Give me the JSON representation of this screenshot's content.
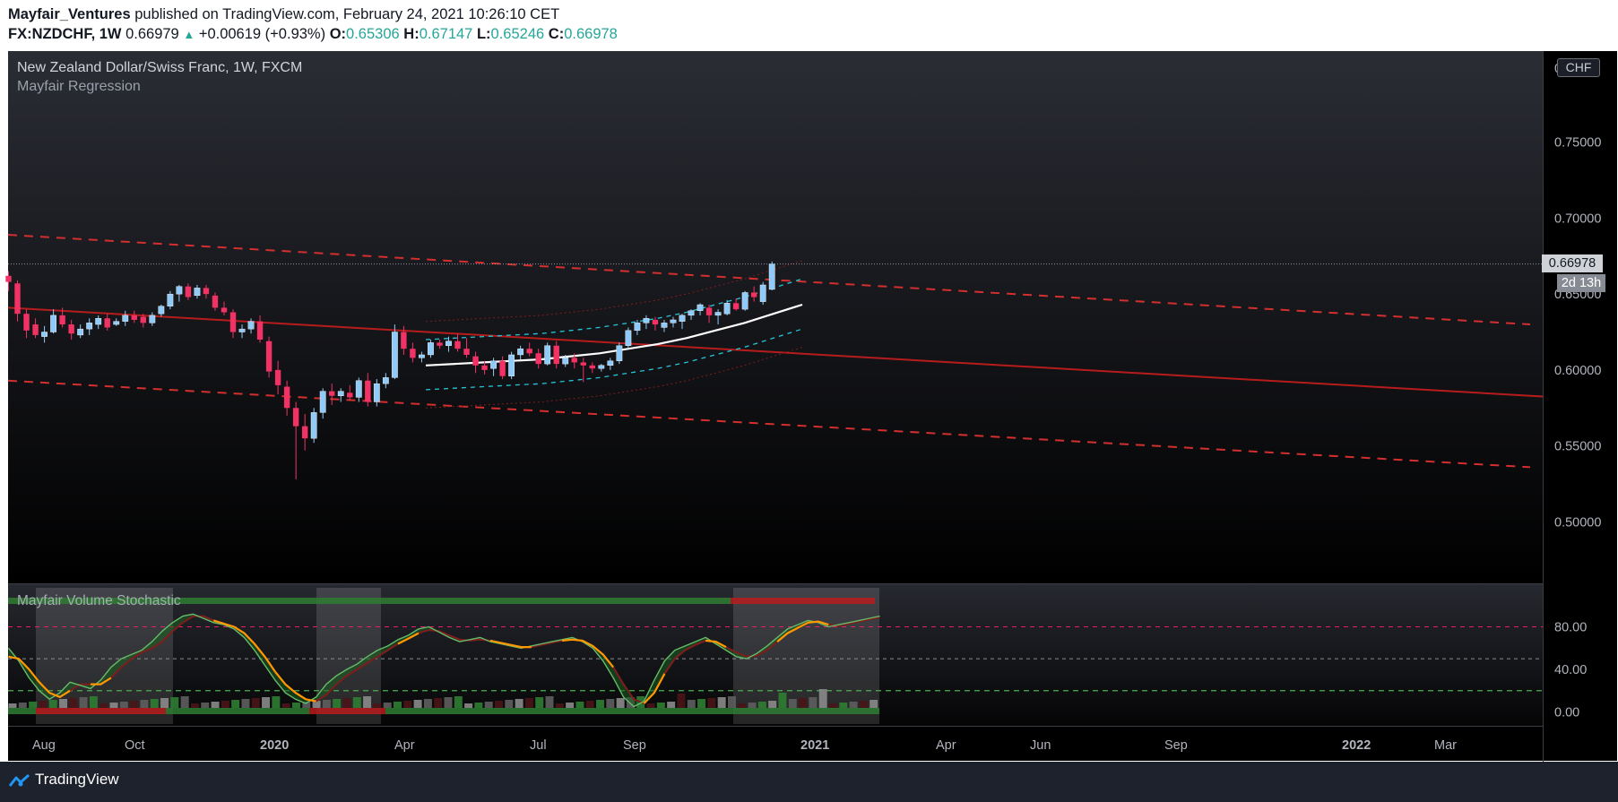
{
  "header": {
    "author": "Mayfair_Ventures",
    "published": " published on TradingView.com, February 24, 2021 10:26:10 CET",
    "symbol": "FX:NZDCHF, 1W",
    "last": "0.66979",
    "arrow": "▲",
    "change": "+0.00619 (+0.93%)",
    "o_label": "O:",
    "o_value": "0.65306",
    "h_label": "H:",
    "h_value": "0.67147",
    "l_label": "L:",
    "l_value": "0.65246",
    "c_label": "C:",
    "c_value": "0.66978"
  },
  "legend": {
    "title": "New Zealand Dollar/Swiss Franc, 1W, FXCM",
    "indicator": "Mayfair Regression",
    "volume_indicator": "Mayfair Volume Stochastic"
  },
  "price_scale": {
    "currency": "CHF",
    "price_tag": "0.66978",
    "countdown": "2d 13h"
  },
  "footer": {
    "brand": "TradingView"
  },
  "colors": {
    "bull": "#90caf9",
    "bear": "#f23264",
    "regression_solid": "#b71c1c",
    "regression_dashed": "#d32f2f",
    "channel": "#26c6da",
    "stoch_fast": "#26a69a",
    "stoch_slow": "#ff9800",
    "level_upper": "#e91e63",
    "level_lower": "#4caf50"
  },
  "chart_data": [
    {
      "type": "candlestick",
      "title": "New Zealand Dollar/Swiss Franc, 1W, FXCM",
      "x_ticks": [
        "Aug",
        "Oct",
        "2020",
        "Apr",
        "Jul",
        "Sep",
        "2021",
        "Apr",
        "Jun",
        "Sep",
        "2022",
        "Mar"
      ],
      "y_ticks": [
        "0.50000",
        "0.55000",
        "0.60000",
        "0.65000",
        "0.70000",
        "0.75000"
      ],
      "ylim": [
        0.46,
        0.8
      ],
      "last_close": 0.66978,
      "candles": [
        {
          "o": 0.662,
          "h": 0.665,
          "l": 0.652,
          "c": 0.658
        },
        {
          "o": 0.657,
          "h": 0.659,
          "l": 0.632,
          "c": 0.637
        },
        {
          "o": 0.637,
          "h": 0.64,
          "l": 0.621,
          "c": 0.626
        },
        {
          "o": 0.63,
          "h": 0.634,
          "l": 0.621,
          "c": 0.623
        },
        {
          "o": 0.622,
          "h": 0.629,
          "l": 0.618,
          "c": 0.625
        },
        {
          "o": 0.625,
          "h": 0.64,
          "l": 0.624,
          "c": 0.636
        },
        {
          "o": 0.636,
          "h": 0.641,
          "l": 0.628,
          "c": 0.63
        },
        {
          "o": 0.63,
          "h": 0.633,
          "l": 0.62,
          "c": 0.624
        },
        {
          "o": 0.623,
          "h": 0.63,
          "l": 0.621,
          "c": 0.627
        },
        {
          "o": 0.627,
          "h": 0.634,
          "l": 0.623,
          "c": 0.631
        },
        {
          "o": 0.63,
          "h": 0.636,
          "l": 0.627,
          "c": 0.634
        },
        {
          "o": 0.634,
          "h": 0.637,
          "l": 0.626,
          "c": 0.628
        },
        {
          "o": 0.63,
          "h": 0.634,
          "l": 0.629,
          "c": 0.632
        },
        {
          "o": 0.632,
          "h": 0.639,
          "l": 0.629,
          "c": 0.636
        },
        {
          "o": 0.636,
          "h": 0.639,
          "l": 0.631,
          "c": 0.633
        },
        {
          "o": 0.635,
          "h": 0.637,
          "l": 0.628,
          "c": 0.631
        },
        {
          "o": 0.631,
          "h": 0.638,
          "l": 0.629,
          "c": 0.636
        },
        {
          "o": 0.637,
          "h": 0.643,
          "l": 0.635,
          "c": 0.642
        },
        {
          "o": 0.642,
          "h": 0.652,
          "l": 0.64,
          "c": 0.65
        },
        {
          "o": 0.65,
          "h": 0.656,
          "l": 0.645,
          "c": 0.655
        },
        {
          "o": 0.655,
          "h": 0.657,
          "l": 0.646,
          "c": 0.648
        },
        {
          "o": 0.649,
          "h": 0.656,
          "l": 0.647,
          "c": 0.654
        },
        {
          "o": 0.654,
          "h": 0.656,
          "l": 0.647,
          "c": 0.65
        },
        {
          "o": 0.649,
          "h": 0.651,
          "l": 0.639,
          "c": 0.641
        },
        {
          "o": 0.641,
          "h": 0.645,
          "l": 0.636,
          "c": 0.638
        },
        {
          "o": 0.638,
          "h": 0.64,
          "l": 0.621,
          "c": 0.625
        },
        {
          "o": 0.625,
          "h": 0.63,
          "l": 0.621,
          "c": 0.627
        },
        {
          "o": 0.627,
          "h": 0.634,
          "l": 0.624,
          "c": 0.632
        },
        {
          "o": 0.632,
          "h": 0.636,
          "l": 0.618,
          "c": 0.62
        },
        {
          "o": 0.619,
          "h": 0.622,
          "l": 0.595,
          "c": 0.599
        },
        {
          "o": 0.6,
          "h": 0.606,
          "l": 0.584,
          "c": 0.59
        },
        {
          "o": 0.589,
          "h": 0.593,
          "l": 0.57,
          "c": 0.575
        },
        {
          "o": 0.575,
          "h": 0.579,
          "l": 0.528,
          "c": 0.563
        },
        {
          "o": 0.563,
          "h": 0.571,
          "l": 0.547,
          "c": 0.555
        },
        {
          "o": 0.555,
          "h": 0.575,
          "l": 0.552,
          "c": 0.572
        },
        {
          "o": 0.572,
          "h": 0.588,
          "l": 0.568,
          "c": 0.586
        },
        {
          "o": 0.586,
          "h": 0.591,
          "l": 0.577,
          "c": 0.583
        },
        {
          "o": 0.583,
          "h": 0.588,
          "l": 0.579,
          "c": 0.586
        },
        {
          "o": 0.585,
          "h": 0.59,
          "l": 0.58,
          "c": 0.582
        },
        {
          "o": 0.582,
          "h": 0.595,
          "l": 0.579,
          "c": 0.593
        },
        {
          "o": 0.593,
          "h": 0.598,
          "l": 0.576,
          "c": 0.579
        },
        {
          "o": 0.579,
          "h": 0.594,
          "l": 0.576,
          "c": 0.591
        },
        {
          "o": 0.591,
          "h": 0.598,
          "l": 0.588,
          "c": 0.595
        },
        {
          "o": 0.595,
          "h": 0.63,
          "l": 0.594,
          "c": 0.625
        },
        {
          "o": 0.625,
          "h": 0.629,
          "l": 0.61,
          "c": 0.614
        },
        {
          "o": 0.614,
          "h": 0.618,
          "l": 0.605,
          "c": 0.608
        },
        {
          "o": 0.608,
          "h": 0.612,
          "l": 0.605,
          "c": 0.61
        },
        {
          "o": 0.61,
          "h": 0.62,
          "l": 0.608,
          "c": 0.618
        },
        {
          "o": 0.618,
          "h": 0.62,
          "l": 0.614,
          "c": 0.616
        },
        {
          "o": 0.616,
          "h": 0.622,
          "l": 0.612,
          "c": 0.619
        },
        {
          "o": 0.619,
          "h": 0.624,
          "l": 0.612,
          "c": 0.614
        },
        {
          "o": 0.614,
          "h": 0.621,
          "l": 0.608,
          "c": 0.61
        },
        {
          "o": 0.609,
          "h": 0.612,
          "l": 0.598,
          "c": 0.603
        },
        {
          "o": 0.603,
          "h": 0.606,
          "l": 0.597,
          "c": 0.6
        },
        {
          "o": 0.601,
          "h": 0.608,
          "l": 0.596,
          "c": 0.606
        },
        {
          "o": 0.606,
          "h": 0.609,
          "l": 0.594,
          "c": 0.596
        },
        {
          "o": 0.596,
          "h": 0.612,
          "l": 0.594,
          "c": 0.61
        },
        {
          "o": 0.61,
          "h": 0.616,
          "l": 0.607,
          "c": 0.614
        },
        {
          "o": 0.614,
          "h": 0.618,
          "l": 0.609,
          "c": 0.611
        },
        {
          "o": 0.611,
          "h": 0.614,
          "l": 0.601,
          "c": 0.604
        },
        {
          "o": 0.604,
          "h": 0.618,
          "l": 0.603,
          "c": 0.616
        },
        {
          "o": 0.616,
          "h": 0.619,
          "l": 0.601,
          "c": 0.604
        },
        {
          "o": 0.604,
          "h": 0.61,
          "l": 0.602,
          "c": 0.608
        },
        {
          "o": 0.608,
          "h": 0.611,
          "l": 0.601,
          "c": 0.605
        },
        {
          "o": 0.605,
          "h": 0.608,
          "l": 0.592,
          "c": 0.603
        },
        {
          "o": 0.603,
          "h": 0.605,
          "l": 0.598,
          "c": 0.601
        },
        {
          "o": 0.601,
          "h": 0.604,
          "l": 0.599,
          "c": 0.603
        },
        {
          "o": 0.603,
          "h": 0.608,
          "l": 0.6,
          "c": 0.606
        },
        {
          "o": 0.606,
          "h": 0.618,
          "l": 0.604,
          "c": 0.616
        },
        {
          "o": 0.616,
          "h": 0.628,
          "l": 0.614,
          "c": 0.626
        },
        {
          "o": 0.626,
          "h": 0.633,
          "l": 0.623,
          "c": 0.631
        },
        {
          "o": 0.631,
          "h": 0.636,
          "l": 0.627,
          "c": 0.634
        },
        {
          "o": 0.633,
          "h": 0.635,
          "l": 0.626,
          "c": 0.63
        },
        {
          "o": 0.628,
          "h": 0.633,
          "l": 0.625,
          "c": 0.631
        },
        {
          "o": 0.631,
          "h": 0.635,
          "l": 0.628,
          "c": 0.633
        },
        {
          "o": 0.632,
          "h": 0.637,
          "l": 0.627,
          "c": 0.636
        },
        {
          "o": 0.636,
          "h": 0.64,
          "l": 0.633,
          "c": 0.639
        },
        {
          "o": 0.639,
          "h": 0.644,
          "l": 0.636,
          "c": 0.643
        },
        {
          "o": 0.641,
          "h": 0.643,
          "l": 0.631,
          "c": 0.636
        },
        {
          "o": 0.636,
          "h": 0.64,
          "l": 0.63,
          "c": 0.638
        },
        {
          "o": 0.637,
          "h": 0.646,
          "l": 0.636,
          "c": 0.644
        },
        {
          "o": 0.644,
          "h": 0.647,
          "l": 0.639,
          "c": 0.64
        },
        {
          "o": 0.64,
          "h": 0.652,
          "l": 0.639,
          "c": 0.651
        },
        {
          "o": 0.651,
          "h": 0.655,
          "l": 0.645,
          "c": 0.648
        },
        {
          "o": 0.645,
          "h": 0.658,
          "l": 0.643,
          "c": 0.656
        },
        {
          "o": 0.65306,
          "h": 0.67147,
          "l": 0.65246,
          "c": 0.66978
        }
      ],
      "regression": {
        "center": [
          0.641,
          0.583
        ],
        "upper": [
          0.689,
          0.63
        ],
        "lower": [
          0.593,
          0.536
        ]
      },
      "short_regression": {
        "line": [
          0.603,
          0.604,
          0.605,
          0.606,
          0.607,
          0.609,
          0.611,
          0.614,
          0.617,
          0.621,
          0.626,
          0.631,
          0.637,
          0.643
        ],
        "upper": [
          0.62,
          0.621,
          0.622,
          0.623,
          0.624,
          0.626,
          0.628,
          0.631,
          0.634,
          0.638,
          0.643,
          0.648,
          0.654,
          0.66
        ],
        "lower": [
          0.587,
          0.588,
          0.589,
          0.59,
          0.591,
          0.593,
          0.595,
          0.598,
          0.601,
          0.605,
          0.61,
          0.615,
          0.621,
          0.627
        ]
      }
    },
    {
      "type": "line",
      "title": "Mayfair Volume Stochastic",
      "y_ticks": [
        "0.00",
        "40.00",
        "80.00"
      ],
      "ylim": [
        -12,
        110
      ],
      "levels": [
        80,
        50,
        20
      ],
      "series": [
        {
          "values": [
            60,
            48,
            32,
            20,
            12,
            18,
            28,
            25,
            22,
            30,
            42,
            50,
            54,
            58,
            66,
            76,
            84,
            90,
            92,
            88,
            84,
            82,
            78,
            70,
            58,
            44,
            30,
            18,
            12,
            8,
            14,
            26,
            34,
            40,
            45,
            52,
            58,
            62,
            68,
            72,
            78,
            80,
            75,
            70,
            66,
            68,
            70,
            66,
            64,
            62,
            60,
            62,
            64,
            66,
            68,
            70,
            66,
            60,
            48,
            32,
            14,
            5,
            10,
            30,
            48,
            58,
            62,
            66,
            70,
            64,
            58,
            52,
            50,
            55,
            62,
            70,
            78,
            82,
            86,
            84,
            80,
            82,
            84,
            86,
            88,
            90
          ]
        },
        {
          "values": [
            52,
            50,
            40,
            28,
            18,
            14,
            20,
            26,
            26,
            26,
            32,
            42,
            50,
            56,
            60,
            66,
            76,
            84,
            90,
            90,
            86,
            83,
            80,
            74,
            64,
            52,
            38,
            26,
            18,
            12,
            10,
            16,
            26,
            34,
            40,
            46,
            52,
            58,
            64,
            69,
            74,
            77,
            76,
            72,
            68,
            67,
            68,
            67,
            65,
            63,
            61,
            61,
            63,
            65,
            67,
            68,
            67,
            62,
            54,
            42,
            26,
            12,
            8,
            18,
            36,
            50,
            58,
            63,
            67,
            66,
            61,
            56,
            52,
            53,
            58,
            66,
            74,
            79,
            84,
            85,
            82,
            81,
            83,
            85,
            87,
            89
          ]
        }
      ]
    }
  ]
}
